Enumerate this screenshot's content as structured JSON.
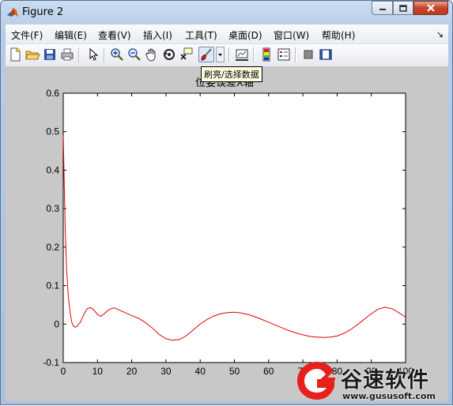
{
  "window": {
    "title": "Figure 2"
  },
  "menu": [
    {
      "label": "文件(F)"
    },
    {
      "label": "编辑(E)"
    },
    {
      "label": "查看(V)"
    },
    {
      "label": "插入(I)"
    },
    {
      "label": "工具(T)"
    },
    {
      "label": "桌面(D)"
    },
    {
      "label": "窗口(W)"
    },
    {
      "label": "帮助(H)"
    }
  ],
  "toolbar": {
    "tooltip": "刷亮/选择数据",
    "icons": [
      "new-figure-icon",
      "open-file-icon",
      "save-icon",
      "print-icon",
      "pointer-icon",
      "zoom-in-icon",
      "zoom-out-icon",
      "pan-hand-icon",
      "rotate-3d-icon",
      "data-cursor-icon",
      "brush-icon",
      "dropdown-arrow-icon",
      "link-plot-icon",
      "colorbar-icon",
      "legend-icon",
      "hide-plot-tools-icon",
      "show-plot-tools-icon"
    ]
  },
  "chart_data": {
    "type": "line",
    "title": "位姿误差X轴",
    "xlabel": "",
    "ylabel": "",
    "xlim": [
      0,
      100
    ],
    "ylim": [
      -0.1,
      0.6
    ],
    "xticks": [
      "0",
      "10",
      "20",
      "30",
      "40",
      "50",
      "60",
      "70",
      "80",
      "90",
      "100"
    ],
    "yticks": [
      "0.6",
      "0.5",
      "0.4",
      "0.3",
      "0.2",
      "0.1",
      "0",
      "-0.1"
    ],
    "series": [
      {
        "color": "#e00000",
        "x": [
          0,
          0.3,
          0.6,
          1,
          1.5,
          2,
          2.5,
          3,
          3.5,
          4,
          5,
          6,
          7,
          8,
          9,
          10,
          11,
          12,
          13,
          14,
          15,
          16,
          18,
          20,
          22,
          24,
          26,
          28,
          30,
          32,
          34,
          36,
          38,
          40,
          42,
          44,
          46,
          48,
          50,
          52,
          54,
          56,
          58,
          60,
          62,
          64,
          66,
          68,
          70,
          72,
          74,
          76,
          78,
          80,
          82,
          84,
          86,
          88,
          90,
          92,
          94,
          96,
          98,
          100
        ],
        "y": [
          0.49,
          0.36,
          0.24,
          0.14,
          0.07,
          0.03,
          0.005,
          -0.006,
          -0.008,
          -0.006,
          0.005,
          0.025,
          0.04,
          0.043,
          0.036,
          0.025,
          0.02,
          0.027,
          0.035,
          0.04,
          0.042,
          0.038,
          0.03,
          0.022,
          0.015,
          0.004,
          -0.01,
          -0.027,
          -0.038,
          -0.042,
          -0.04,
          -0.03,
          -0.015,
          0,
          0.012,
          0.021,
          0.027,
          0.03,
          0.031,
          0.029,
          0.025,
          0.019,
          0.012,
          0.005,
          -0.003,
          -0.01,
          -0.017,
          -0.023,
          -0.028,
          -0.032,
          -0.034,
          -0.035,
          -0.034,
          -0.031,
          -0.024,
          -0.014,
          -0.001,
          0.013,
          0.027,
          0.039,
          0.044,
          0.04,
          0.03,
          0.018
        ]
      }
    ],
    "grid": false
  },
  "watermark": {
    "text": "谷速软件",
    "url": "www.gususoft.com"
  }
}
